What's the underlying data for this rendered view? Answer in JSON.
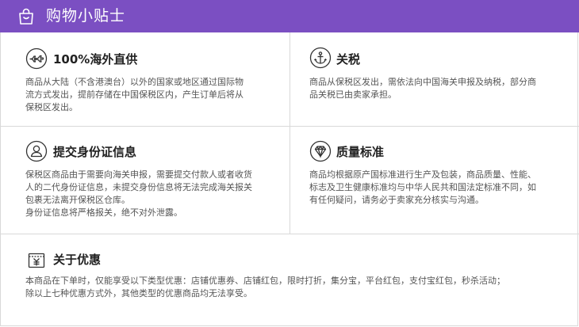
{
  "header": {
    "title": "购物小贴士",
    "icon": "shopping-bag-icon",
    "background": "#7b4fc2"
  },
  "tips": [
    {
      "icon": "airplane-icon",
      "heading": "100%海外直供",
      "lines": [
        "商品从大陆（不含港澳台）以外的国家或地区通过国际物",
        "流方式发出，提前存储在中国保税区内，产生订单后将从",
        "保税区发出。"
      ]
    },
    {
      "icon": "anchor-icon",
      "heading": "关税",
      "lines": [
        "商品从保税区发出，需依法向中国海关申报及纳税，部分商",
        "品关税已由卖家承担。"
      ]
    },
    {
      "icon": "person-icon",
      "heading": "提交身份证信息",
      "lines": [
        "保税区商品由于需要向海关申报，需要提交付款人或者收货",
        "人的二代身份证信息，未提交身份信息将无法完成海关报关",
        "包裹无法离开保税区仓库。",
        "身份证信息将严格报关，绝不对外泄露。"
      ]
    },
    {
      "icon": "diamond-icon",
      "heading": "质量标准",
      "lines": [
        "商品均根据原产国标准进行生产及包装，商品质量、性能、",
        "标志及卫生健康标准均与中华人民共和国法定标准不同，如",
        "有任何疑问，请务必于卖家充分核实与沟通。"
      ]
    },
    {
      "icon": "yen-coupon-icon",
      "heading": "关于优惠",
      "lines": [
        "本商品在下单时，仅能享受以下类型优惠：店铺优惠券、店铺红包，限时打折，集分宝，平台红包，支付宝红包，秒杀活动；",
        "除以上七种优惠方式外，其他类型的优惠商品均无法享受。"
      ]
    }
  ]
}
